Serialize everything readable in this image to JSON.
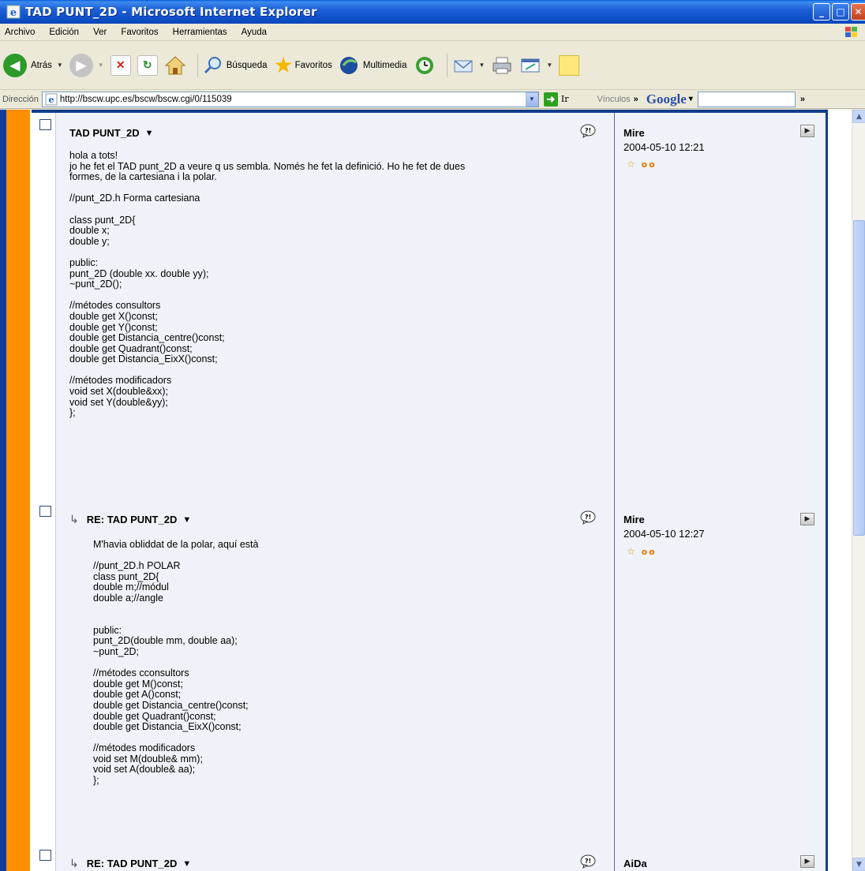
{
  "window": {
    "title": "TAD PUNT_2D - Microsoft Internet Explorer",
    "min_glyph": "_",
    "max_glyph": "□",
    "close_glyph": "✕"
  },
  "menu": [
    "Archivo",
    "Edición",
    "Ver",
    "Favoritos",
    "Herramientas",
    "Ayuda"
  ],
  "toolbar": {
    "back_label": "Atrás",
    "search_label": "Búsqueda",
    "favorites_label": "Favoritos",
    "media_label": "Multimedia"
  },
  "address": {
    "label": "Dirección",
    "url": "http://bscw.upc.es/bscw/bscw.cgi/0/115039",
    "go_label": "Ir",
    "links_label": "Vínculos",
    "google_label": "Google"
  },
  "messages": [
    {
      "title": "TAD PUNT_2D",
      "author": "Mire",
      "date": "2004-05-10 12:21",
      "body": "hola a tots!\njo he fet el TAD punt_2D a veure q us sembla. Només he fet la definició. Ho he fet de dues\nformes, de la cartesiana i la polar.\n\n//punt_2D.h Forma cartesiana\n\nclass punt_2D{\ndouble x;\ndouble y;\n\npublic:\npunt_2D (double xx. double yy);\n~punt_2D();\n\n//métodes consultors\ndouble get X()const;\ndouble get Y()const;\ndouble get Distancia_centre()const;\ndouble get Quadrant()const;\ndouble get Distancia_EixX()const;\n\n//métodes modificadors\nvoid set X(double&xx);\nvoid set Y(double&yy);\n};"
    },
    {
      "title": "RE: TAD PUNT_2D",
      "author": "Mire",
      "date": "2004-05-10 12:27",
      "body": "M'havia obliddat de la polar, aquí està\n\n//punt_2D.h POLAR\nclass punt_2D{\ndouble m;//módul\ndouble a;//angle\n\n\npublic:\npunt_2D(double mm, double aa);\n~punt_2D;\n\n//métodes cconsultors\ndouble get M()const;\ndouble get A()const;\ndouble get Distancia_centre()const;\ndouble get Quadrant()const;\ndouble get Distancia_EixX()const;\n\n//métodes modificadors\nvoid set M(double& mm);\nvoid set A(double& aa);\n};"
    },
    {
      "title": "RE: TAD PUNT_2D",
      "author": "AiDa"
    }
  ],
  "colors": {
    "accent_orange": "#ff8f00",
    "frame_blue": "#123e8a",
    "message_bg": "#eff2f8"
  }
}
